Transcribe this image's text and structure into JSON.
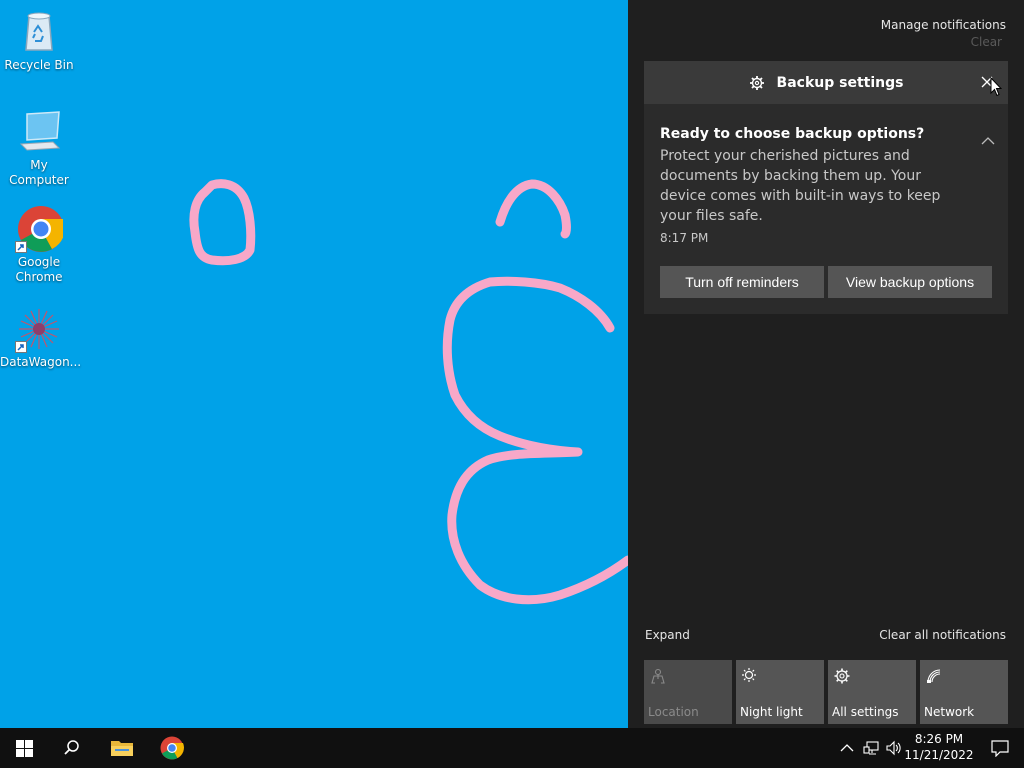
{
  "desktop": {
    "icons": [
      {
        "label": "Recycle Bin",
        "icon": "recycle-bin-icon"
      },
      {
        "label": "My Computer",
        "icon": "computer-icon"
      },
      {
        "label": "Google Chrome",
        "icon": "chrome-icon"
      },
      {
        "label": "DataWagon...",
        "icon": "datawagon-icon"
      }
    ],
    "drawing_color": "#f7a8c8",
    "background_color": "#00a2e8"
  },
  "action_center": {
    "manage_notifications": "Manage notifications",
    "clear": "Clear",
    "notification": {
      "app_name": "Backup settings",
      "title": "Ready to choose backup options?",
      "body": "Protect your cherished pictures and documents by backing them up. Your device comes with built-in ways to keep your files safe.",
      "time": "8:17 PM",
      "buttons": {
        "turn_off": "Turn off reminders",
        "view": "View backup options"
      }
    },
    "expand": "Expand",
    "clear_all": "Clear all notifications",
    "quick_actions": [
      {
        "label": "Location",
        "icon": "location-icon",
        "enabled": false
      },
      {
        "label": "Night light",
        "icon": "night-light-icon",
        "enabled": true
      },
      {
        "label": "All settings",
        "icon": "settings-icon",
        "enabled": true
      },
      {
        "label": "Network",
        "icon": "network-icon",
        "enabled": true
      }
    ]
  },
  "taskbar": {
    "time": "8:26 PM",
    "date": "11/21/2022"
  }
}
